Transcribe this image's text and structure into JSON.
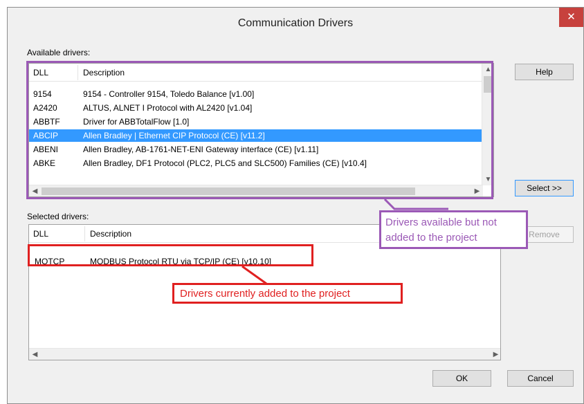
{
  "dialog": {
    "title": "Communication Drivers",
    "close_glyph": "✕"
  },
  "available": {
    "label": "Available drivers:",
    "columns": [
      "DLL",
      "Description"
    ],
    "rows": [
      {
        "dll": "9154",
        "desc": "9154 - Controller 9154, Toledo Balance [v1.00]",
        "selected": false
      },
      {
        "dll": "A2420",
        "desc": "ALTUS, ALNET I Protocol with AL2420 [v1.04]",
        "selected": false
      },
      {
        "dll": "ABBTF",
        "desc": "Driver for ABBTotalFlow [1.0]",
        "selected": false
      },
      {
        "dll": "ABCIP",
        "desc": "Allen Bradley | Ethernet CIP Protocol (CE) [v11.2]",
        "selected": true
      },
      {
        "dll": "ABENI",
        "desc": "Allen Bradley, AB-1761-NET-ENI Gateway interface (CE) [v1.11]",
        "selected": false
      },
      {
        "dll": "ABKE",
        "desc": "Allen Bradley, DF1 Protocol (PLC2, PLC5 and SLC500) Families (CE) [v10.4]",
        "selected": false
      }
    ]
  },
  "selected_drivers": {
    "label": "Selected drivers:",
    "columns": [
      "DLL",
      "Description"
    ],
    "rows": [
      {
        "dll": "MOTCP",
        "desc": "MODBUS Protocol RTU via TCP/IP (CE) [v10.10]"
      }
    ]
  },
  "buttons": {
    "help": "Help",
    "select": "Select >>",
    "remove": "Remove",
    "ok": "OK",
    "cancel": "Cancel"
  },
  "annotations": {
    "available_note_line1": "Drivers available but not",
    "available_note_line2": "added to the project",
    "selected_note": "Drivers currently added to the project",
    "available_color": "#9b59b6",
    "selected_color": "#e02020"
  },
  "colors": {
    "selection": "#3399ff",
    "close_button": "#c7413d"
  }
}
